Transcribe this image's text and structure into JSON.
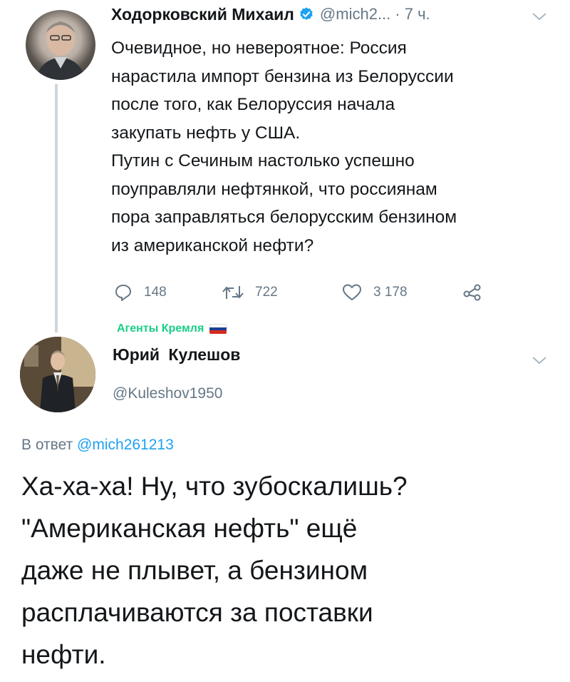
{
  "colors": {
    "text": "#14171a",
    "muted": "#657786",
    "link": "#1da1f2",
    "verified": "#1da1f2",
    "list_tag": "#19cf86",
    "thread_line": "#ccd6dd"
  },
  "tweet": {
    "author_name": "Ходорковский Михаил",
    "handle": "@mich2...",
    "time": "· 7 ч.",
    "text": "Очевидное, но невероятное: Россия\nнарастила импорт бензина из Белоруссии\nпосле того, как Белоруссия начала\nзакупать нефть у США.\nПутин с Сечиным настолько успешно\nпоуправляли нефтянкой, что россиянам\nпора заправляться белорусским бензином\nиз американской нефти?",
    "replies": "148",
    "retweets": "722",
    "likes": "3 178",
    "icons": [
      "reply-icon",
      "retweet-icon",
      "like-icon",
      "share-icon",
      "verified-badge-icon",
      "chevron-down-icon"
    ]
  },
  "reply": {
    "list_tag": "Агенты Кремля",
    "author_name": "Юрий Кулешов",
    "handle": "@Kuleshov1950",
    "reply_prefix": "В ответ",
    "reply_handle": "@mich261213",
    "text": "Ха-ха-ха! Ну, что зубоскалишь?\n\"Американская нефть\" ещё\nдаже не плывет, а бензином\nрасплачиваются за поставки\nнефти."
  }
}
